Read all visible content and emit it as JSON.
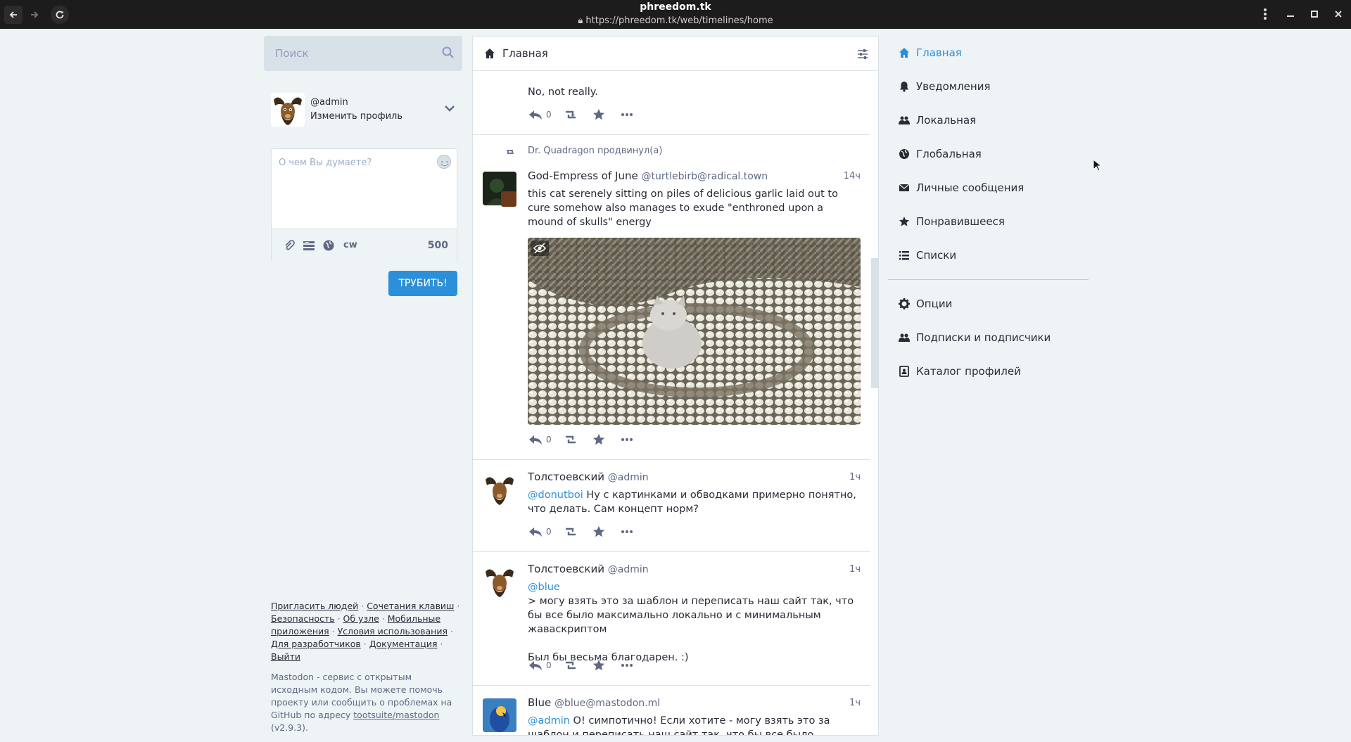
{
  "browser": {
    "title": "phreedom.tk",
    "url": "https://phreedom.tk/web/timelines/home"
  },
  "search": {
    "placeholder": "Поиск"
  },
  "profile": {
    "handle": "@admin",
    "edit_label": "Изменить профиль"
  },
  "compose": {
    "placeholder": "О чем Вы думаете?",
    "cw_label": "cw",
    "char_count": "500",
    "submit_label": "ТРУБИТЬ!"
  },
  "footer": {
    "links": [
      "Пригласить людей",
      "Сочетания клавиш",
      "Безопасность",
      "Об узле",
      "Мобильные приложения",
      "Условия использования",
      "Для разработчиков",
      "Документация",
      "Выйти"
    ],
    "about_text": "Mastodon - сервис с открытым исходным кодом. Вы можете помочь проекту или сообщить о проблемах на GitHub по адресу",
    "about_link": "tootsuite/mastodon",
    "version": "(v2.9.3)."
  },
  "column": {
    "title": "Главная",
    "statuses": [
      {
        "content": "No, not really.",
        "reply_count": "0"
      },
      {
        "boosted_by": "Dr. Quadragon продвинул(а)",
        "display_name": "God-Empress of June",
        "acct": "@turtlebirb@radical.town",
        "time": "14ч",
        "content": "this cat serenely sitting on piles of delicious garlic laid out to cure somehow also manages to exude \"enthroned upon a mound of skulls\" energy",
        "reply_count": "0"
      },
      {
        "display_name": "Толстоевский",
        "acct": "@admin",
        "time": "1ч",
        "mention": "@donutboi",
        "content": " Ну с картинками и обводками примерно понятно, что делать. Сам концепт норм?",
        "reply_count": "0"
      },
      {
        "display_name": "Толстоевский",
        "acct": "@admin",
        "time": "1ч",
        "mention": "@blue",
        "quote": "> могу взять это за шаблон и переписать наш сайт так, что бы все было максимально локально и с минимальным жаваскриптом",
        "content": "Был бы весьма благодарен. :)",
        "reply_count": "0"
      },
      {
        "display_name": "Blue",
        "acct": "@blue@mastodon.ml",
        "time": "1ч",
        "mention": "@admin",
        "content": " О! симпотично! Если хотите - могу взять это за шаблон и переписать наш сайт так, что бы все было максимально локально и"
      }
    ]
  },
  "nav": {
    "items": [
      {
        "label": "Главная",
        "icon": "home-icon"
      },
      {
        "label": "Уведомления",
        "icon": "bell-icon"
      },
      {
        "label": "Локальная",
        "icon": "users-icon"
      },
      {
        "label": "Глобальная",
        "icon": "globe-icon"
      },
      {
        "label": "Личные сообщения",
        "icon": "envelope-icon"
      },
      {
        "label": "Понравившееся",
        "icon": "star-icon"
      },
      {
        "label": "Списки",
        "icon": "list-icon"
      },
      {
        "label": "Опции",
        "icon": "gear-icon"
      },
      {
        "label": "Подписки и подписчики",
        "icon": "users-icon"
      },
      {
        "label": "Каталог профилей",
        "icon": "address-book-icon"
      }
    ]
  },
  "colors": {
    "accent": "#2b90d9",
    "background": "#eef3f5",
    "text": "#282c37",
    "muted": "#606984"
  }
}
